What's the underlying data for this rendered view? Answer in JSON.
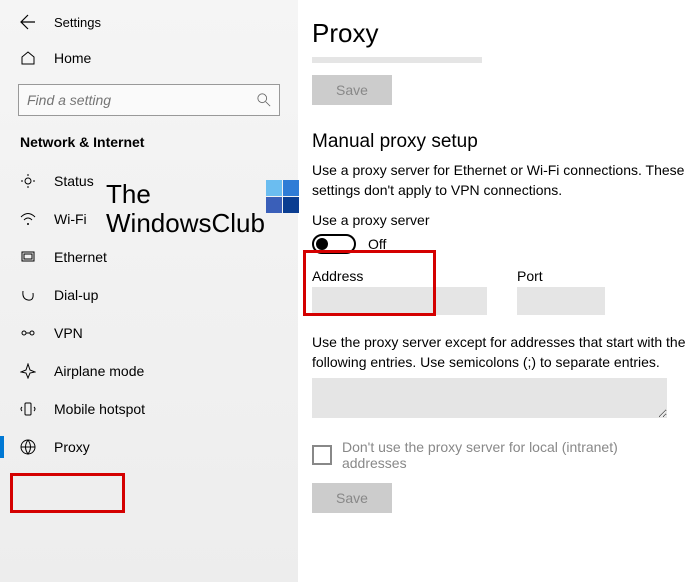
{
  "header": {
    "settings": "Settings"
  },
  "home": {
    "label": "Home"
  },
  "search": {
    "placeholder": "Find a setting"
  },
  "category": "Network & Internet",
  "nav": [
    {
      "label": "Status"
    },
    {
      "label": "Wi-Fi"
    },
    {
      "label": "Ethernet"
    },
    {
      "label": "Dial-up"
    },
    {
      "label": "VPN"
    },
    {
      "label": "Airplane mode"
    },
    {
      "label": "Mobile hotspot"
    },
    {
      "label": "Proxy"
    }
  ],
  "watermark": {
    "line1": "The",
    "line2": "WindowsClub"
  },
  "main": {
    "title": "Proxy",
    "save": "Save",
    "section": "Manual proxy setup",
    "desc": "Use a proxy server for Ethernet or Wi-Fi connections. These settings don't apply to VPN connections.",
    "toggle_label": "Use a proxy server",
    "toggle_state": "Off",
    "address_label": "Address",
    "port_label": "Port",
    "exceptions_desc": "Use the proxy server except for addresses that start with the following entries. Use semicolons (;) to separate entries.",
    "local_label": "Don't use the proxy server for local (intranet) addresses",
    "save2": "Save"
  }
}
